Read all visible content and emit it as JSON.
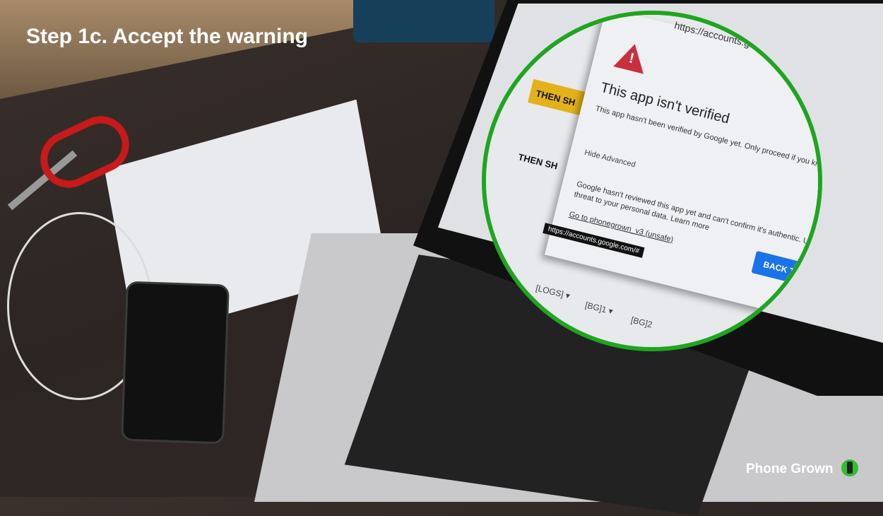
{
  "slide": {
    "heading": "Step 1c. Accept the warning",
    "brand": "Phone Grown"
  },
  "dialog": {
    "url": "https://accounts.google.com/signin",
    "title": "This app isn't verified",
    "message": "This app hasn't been verified by Google yet. Only proceed if you know and trust the developer.",
    "hide_advanced": "Hide Advanced",
    "advanced_text": "Google hasn't reviewed this app yet and can't confirm it's authentic. Unverified apps may pose a threat to your personal data.",
    "learn_more": "Learn more",
    "go_to_link": "Go to phonegrown_v3 (unsafe)",
    "status_tooltip": "https://accounts.google.com/#",
    "back_button": "BACK TO SAFETY"
  },
  "sheet": {
    "cell1": "THEN SH",
    "cell2": "THEN SH",
    "tab1": "[LOGS]",
    "tab2": "[BG]1",
    "tab3": "[BG]2"
  },
  "colors": {
    "highlight": "#1fa51f",
    "button": "#1a73e8",
    "warning": "#c8303d"
  }
}
